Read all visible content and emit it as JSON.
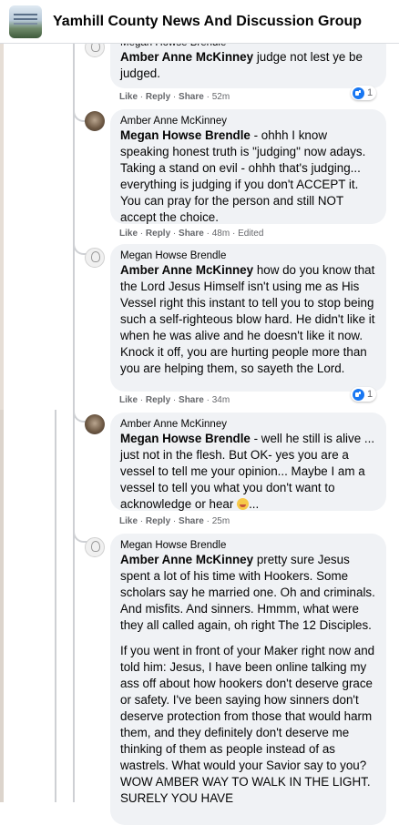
{
  "header": {
    "group_name": "Yamhill County News And Discussion Group"
  },
  "comments": [
    {
      "author": "Megan Howse Brendle",
      "mention": "Amber Anne McKinney",
      "text": " judge not lest ye be judged.",
      "actions": {
        "like": "Like",
        "reply": "Reply",
        "share": "Share",
        "time": "52m",
        "edited": ""
      },
      "reaction_count": "1"
    },
    {
      "author": "Amber Anne McKinney",
      "mention": "Megan Howse Brendle",
      "text": " - ohhh I know speaking honest truth is \"judging\" now adays. Taking a stand on evil - ohhh that's judging... everything is judging if you don't ACCEPT it. You can pray for the person and still NOT accept the choice.",
      "actions": {
        "like": "Like",
        "reply": "Reply",
        "share": "Share",
        "time": "48m",
        "edited": "Edited"
      },
      "reaction_count": ""
    },
    {
      "author": "Megan Howse Brendle",
      "mention": "Amber Anne McKinney",
      "text": " how do you know that the Lord Jesus Himself isn't using me as His Vessel right this instant to tell you to stop being such a self-righteous blow hard. He didn't like it when he was alive and he doesn't like it now. Knock it off, you are hurting people more than you are helping them, so sayeth the Lord.",
      "actions": {
        "like": "Like",
        "reply": "Reply",
        "share": "Share",
        "time": "34m",
        "edited": ""
      },
      "reaction_count": "1"
    },
    {
      "author": "Amber Anne McKinney",
      "mention": "Megan Howse Brendle",
      "text": " - well he still is alive ... just not in the flesh. But OK- yes you are a vessel to tell me your opinion... Maybe I am a vessel to tell you what you don't want to acknowledge or hear",
      "text_tail": "...",
      "emoji": "grinning-face-emoji",
      "actions": {
        "like": "Like",
        "reply": "Reply",
        "share": "Share",
        "time": "25m",
        "edited": ""
      },
      "reaction_count": ""
    },
    {
      "author": "Megan Howse Brendle",
      "mention": "Amber Anne McKinney",
      "text": " pretty sure Jesus spent a lot of his time with Hookers. Some scholars say he married one. Oh and criminals. And misfits. And sinners. Hmmm, what were they all called again, oh right The 12 Disciples.",
      "text2": "If you went in front of your Maker right now and told him: Jesus, I have been online talking my ass off about how hookers don't deserve grace or safety. I've been saying how sinners don't deserve protection from those that would harm them, and they definitely don't deserve me thinking of them as people instead of as wastrels. What would your Savior say to you? WOW AMBER WAY TO WALK IN THE LIGHT. SURELY YOU HAVE"
    }
  ],
  "colors": {
    "bubble": "#f0f2f5",
    "meta": "#65676b",
    "like_blue": "#1877f2",
    "thread_line": "#ced0d4"
  }
}
